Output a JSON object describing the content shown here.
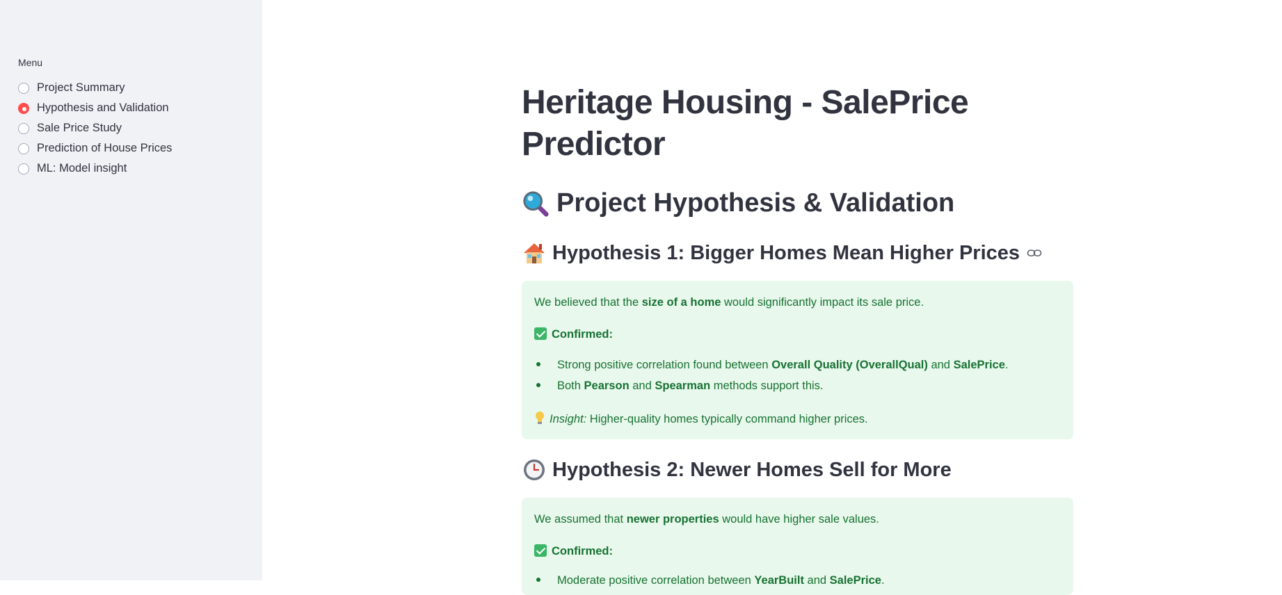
{
  "sidebar": {
    "menu_label": "Menu",
    "items": [
      {
        "label": "Project Summary",
        "selected": false
      },
      {
        "label": "Hypothesis and Validation",
        "selected": true
      },
      {
        "label": "Sale Price Study",
        "selected": false
      },
      {
        "label": "Prediction of House Prices",
        "selected": false
      },
      {
        "label": "ML: Model insight",
        "selected": false
      }
    ]
  },
  "main": {
    "title": "Heritage Housing - SalePrice Predictor",
    "section_heading": "Project Hypothesis & Validation",
    "hypothesis1": {
      "heading": "Hypothesis 1: Bigger Homes Mean Higher Prices",
      "intro_pre": "We believed that the ",
      "intro_bold": "size of a home",
      "intro_post": " would significantly impact its sale price.",
      "confirmed": "Confirmed:",
      "bullet1_pre": "Strong positive correlation found between ",
      "bullet1_b1": "Overall Quality (OverallQual)",
      "bullet1_mid": " and ",
      "bullet1_b2": "SalePrice",
      "bullet1_post": ".",
      "bullet2_pre": "Both ",
      "bullet2_b1": "Pearson",
      "bullet2_mid": " and ",
      "bullet2_b2": "Spearman",
      "bullet2_post": " methods support this.",
      "insight_label": "Insight:",
      "insight_text": " Higher-quality homes typically command higher prices."
    },
    "hypothesis2": {
      "heading": "Hypothesis 2: Newer Homes Sell for More",
      "intro_pre": "We assumed that ",
      "intro_bold": "newer properties",
      "intro_post": " would have higher sale values.",
      "confirmed": "Confirmed:",
      "bullet1_pre": "Moderate positive correlation between ",
      "bullet1_b1": "YearBuilt",
      "bullet1_mid": " and ",
      "bullet1_b2": "SalePrice",
      "bullet1_post": "."
    }
  },
  "colors": {
    "sidebar_bg": "#f0f2f6",
    "accent": "#ff4b4b",
    "callout_bg": "#e8f8ec",
    "callout_text": "#177233"
  },
  "icons": [
    "magnifier-icon",
    "house-icon",
    "link-icon",
    "clock-icon",
    "checkmark-icon",
    "lightbulb-icon"
  ]
}
